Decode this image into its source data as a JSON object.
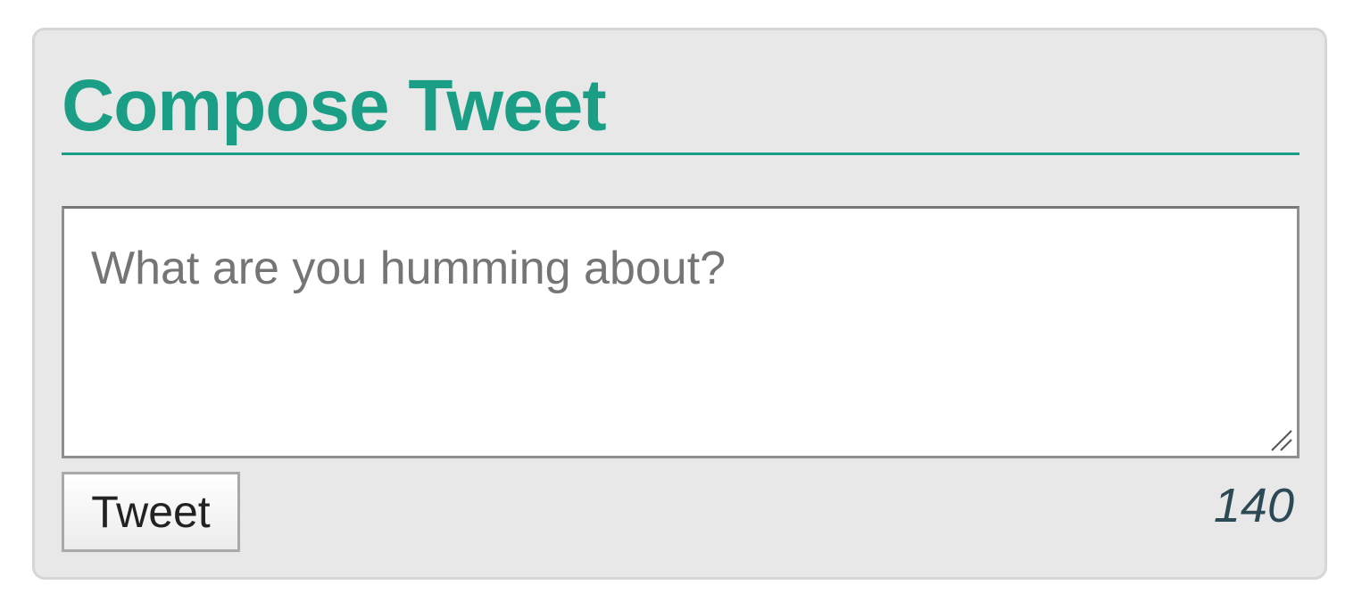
{
  "compose": {
    "title": "Compose Tweet",
    "textarea_placeholder": "What are you humming about?",
    "textarea_value": "",
    "tweet_button_label": "Tweet",
    "char_count": "140"
  },
  "colors": {
    "accent": "#1a9e85",
    "card_background": "#e8e8e8",
    "counter_text": "#2b4a55"
  },
  "icons": {
    "resize_handle": "resize-grip-icon"
  }
}
